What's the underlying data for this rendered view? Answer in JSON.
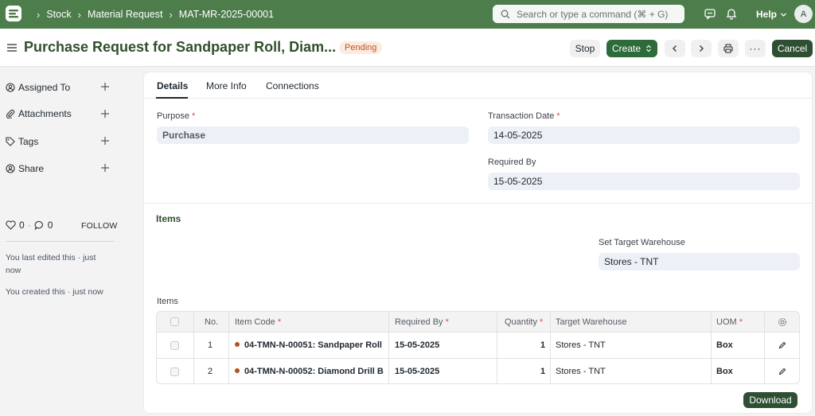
{
  "colors": {
    "navbar": "#4d7d4b",
    "title": "#31502c",
    "primary_button": "#2e6b3b",
    "badge_bg": "#fcebe1",
    "badge_text": "#c0541e"
  },
  "navbar": {
    "breadcrumbs": [
      "Stock",
      "Material Request",
      "MAT-MR-2025-00001"
    ],
    "search_placeholder": "Search or type a command (⌘ + G)",
    "help_label": "Help",
    "avatar_initial": "A",
    "icons": [
      "app-logo-icon",
      "search-icon",
      "chat-icon",
      "bell-icon",
      "chevron-down-icon"
    ]
  },
  "header": {
    "title": "Purchase Request for Sandpaper Roll, Diam...",
    "status": "Pending",
    "buttons": {
      "stop": "Stop",
      "create": "Create",
      "cancel": "Cancel"
    }
  },
  "sidebar": {
    "items": [
      {
        "label": "Assigned To",
        "icon": "user-assign-icon"
      },
      {
        "label": "Attachments",
        "icon": "paperclip-icon"
      },
      {
        "label": "Tags",
        "icon": "tag-icon"
      },
      {
        "label": "Share",
        "icon": "share-icon"
      }
    ],
    "likes": "0",
    "comments": "0",
    "dot": "·",
    "follow_label": "FOLLOW",
    "edited_note": "You last edited this · just now",
    "created_note": "You created this · just now"
  },
  "tabs": [
    "Details",
    "More Info",
    "Connections"
  ],
  "form": {
    "purpose_label": "Purpose",
    "purpose_value": "Purchase",
    "transaction_date_label": "Transaction Date",
    "transaction_date_value": "14-05-2025",
    "required_by_label": "Required By",
    "required_by_value": "15-05-2025",
    "required_mark": "*"
  },
  "items_section": {
    "title": "Items",
    "target_warehouse_label": "Set Target Warehouse",
    "target_warehouse_value": "Stores - TNT",
    "table_label": "Items",
    "columns": {
      "no": "No.",
      "item_code": "Item Code",
      "required_by": "Required By",
      "quantity": "Quantity",
      "target_warehouse": "Target Warehouse",
      "uom": "UOM"
    },
    "rows": [
      {
        "no": "1",
        "item_code": "04-TMN-N-00051: Sandpaper Roll",
        "required_by": "15-05-2025",
        "quantity": "1",
        "target_warehouse": "Stores - TNT",
        "uom": "Box"
      },
      {
        "no": "2",
        "item_code": "04-TMN-N-00052: Diamond Drill B",
        "required_by": "15-05-2025",
        "quantity": "1",
        "target_warehouse": "Stores - TNT",
        "uom": "Box"
      }
    ],
    "download_label": "Download"
  }
}
